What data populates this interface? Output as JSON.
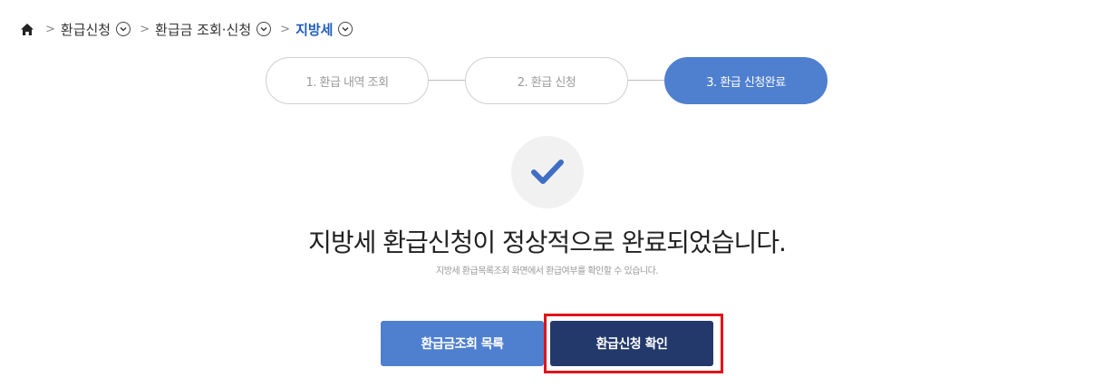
{
  "breadcrumb": {
    "home_icon": "home-icon",
    "items": [
      {
        "label": "환급신청"
      },
      {
        "label": "환급금 조회·신청"
      },
      {
        "label": "지방세"
      }
    ],
    "current_color": "#1f5dbf"
  },
  "steps": [
    {
      "label": "1. 환급 내역 조회",
      "active": false
    },
    {
      "label": "2. 환급 신청",
      "active": false
    },
    {
      "label": "3. 환급 신청완료",
      "active": true
    }
  ],
  "status_icon": "check-icon",
  "message": {
    "title": "지방세 환급신청이 정상적으로 완료되었습니다.",
    "subtitle": "지방세 환급목록조회 화면에서 환급여부를 확인할 수 있습니다."
  },
  "buttons": {
    "list_label": "환급금조회 목록",
    "confirm_label": "환급신청 확인"
  },
  "colors": {
    "accent": "#4f7fcf",
    "primary_dark": "#23396b",
    "highlight": "#e0131b"
  }
}
